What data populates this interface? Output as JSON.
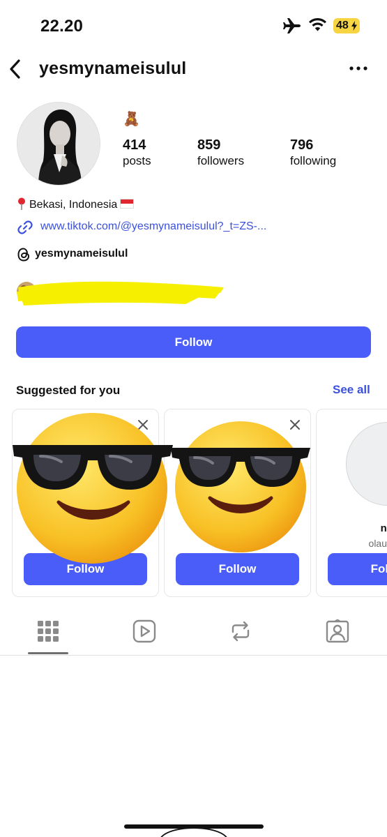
{
  "status_bar": {
    "time": "22.20",
    "battery": "48",
    "icons": [
      "airplane-icon",
      "wifi-icon",
      "battery-charging-icon"
    ]
  },
  "header": {
    "username": "yesmynameisulul",
    "back_icon": "chevron-left-icon",
    "more_icon": "more-horizontal-icon"
  },
  "profile": {
    "status_emoji": "🧸",
    "stats": [
      {
        "value": "414",
        "label": "posts"
      },
      {
        "value": "859",
        "label": "followers"
      },
      {
        "value": "796",
        "label": "following"
      }
    ],
    "location": "Bekasi, Indonesia",
    "link": "www.tiktok.com/@yesmynameisulul?_t=ZS-...",
    "threads_handle": "yesmynameisulul",
    "follow_label": "Follow"
  },
  "suggested": {
    "title": "Suggested for you",
    "see_all": "See all",
    "cards": [
      {
        "name": "",
        "handle": "",
        "follow_label": "Follow"
      },
      {
        "name": "",
        "handle": "",
        "follow_label": "Follow"
      },
      {
        "name": "nec",
        "handle": "olaugh_w",
        "follow_label": "Follow"
      }
    ]
  },
  "tabs": [
    "grid-icon",
    "reels-icon",
    "reposts-icon",
    "tagged-icon"
  ],
  "colors": {
    "accent": "#4a5df9",
    "link": "#3b51dd",
    "battery": "#f6d442",
    "redaction": "#f7ef00"
  }
}
